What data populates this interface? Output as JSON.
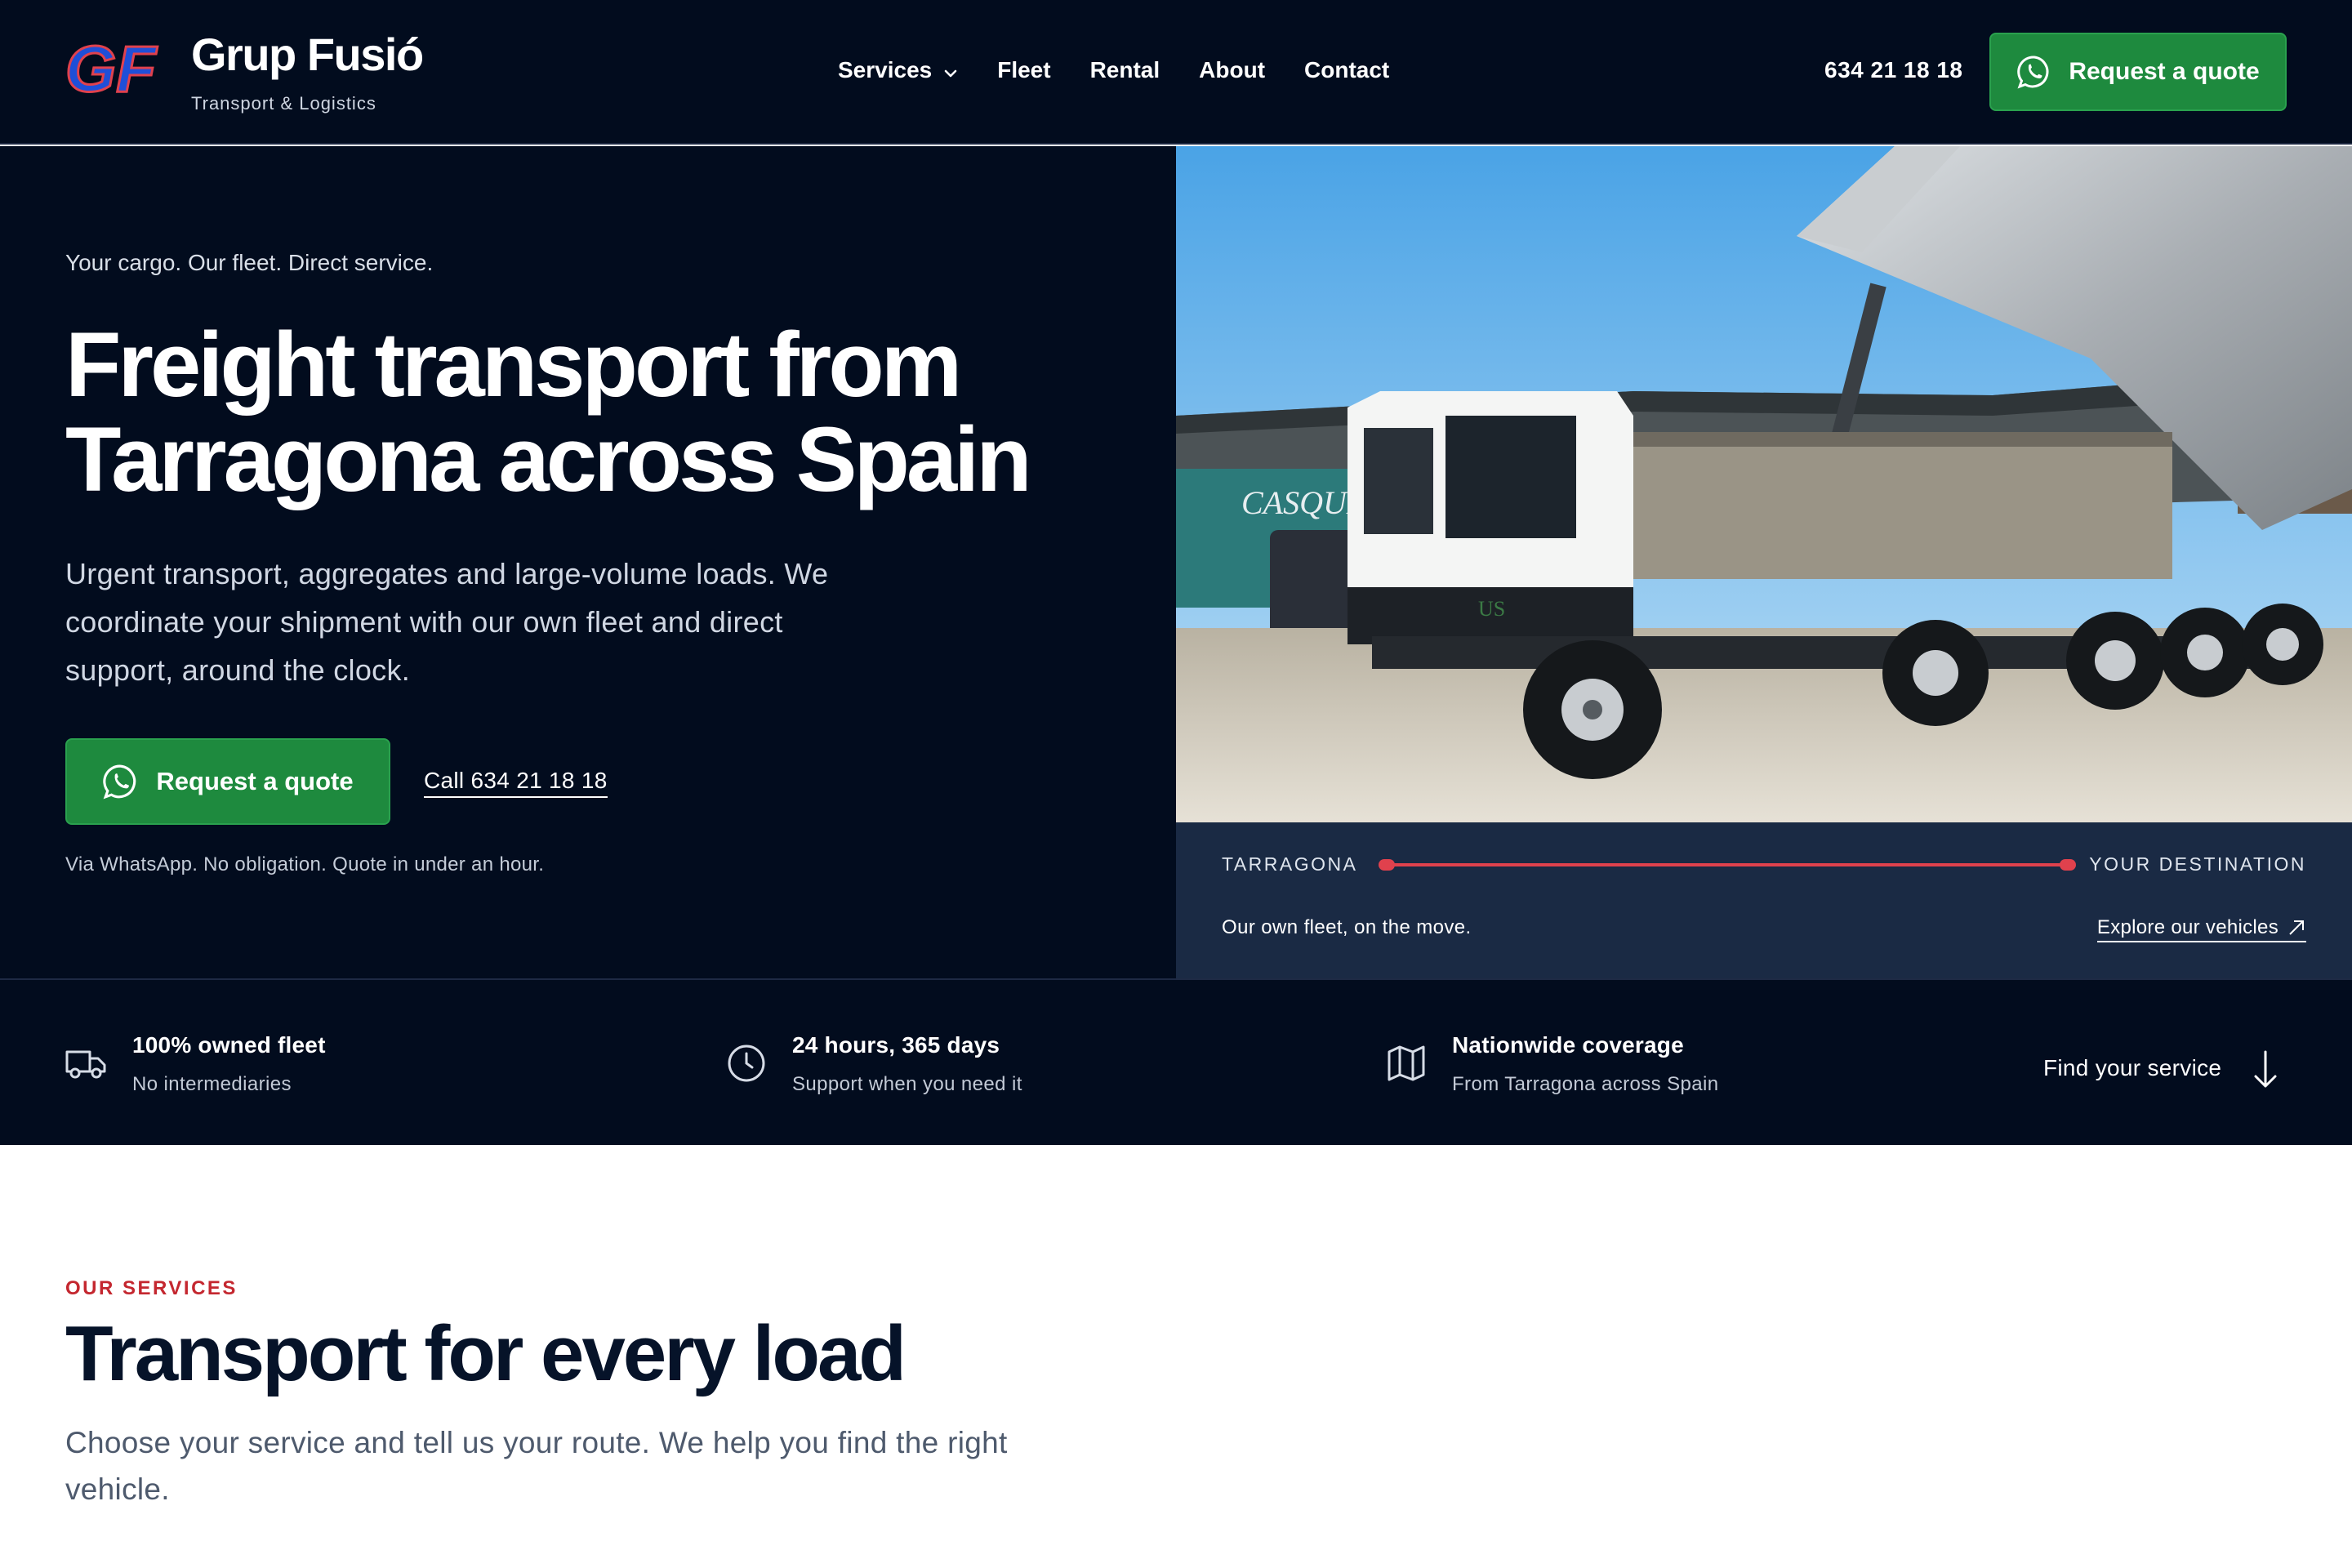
{
  "nav": {
    "brand_name": "Grup Fusió",
    "brand_tagline": "Transport & Logistics",
    "logo_letters": "GF",
    "links": [
      "Services",
      "Fleet",
      "Rental",
      "About",
      "Contact"
    ],
    "phone": "634 21 18 18",
    "cta_label": "Request a quote"
  },
  "hero": {
    "eyebrow": "Your cargo. Our fleet. Direct service.",
    "title": "Freight transport from Tarragona across Spain",
    "subtitle": "Urgent transport, aggregates and large-volume loads. We coordinate your shipment with our own fleet and direct support, around the clock.",
    "cta_label": "Request a quote",
    "call_label": "Call 634 21 18 18",
    "note": "Via WhatsApp. No obligation. Quote in under an hour."
  },
  "route": {
    "origin": "TARRAGONA",
    "destination": "YOUR DESTINATION",
    "caption": "Our own fleet, on the move.",
    "link_label": "Explore our vehicles"
  },
  "photo": {
    "trailer_text": "CASQUE",
    "cab_text": "US"
  },
  "features": [
    {
      "title": "100% owned fleet",
      "subtitle": "No intermediaries",
      "icon": "truck-icon"
    },
    {
      "title": "24 hours, 365 days",
      "subtitle": "Support when you need it",
      "icon": "clock-icon"
    },
    {
      "title": "Nationwide coverage",
      "subtitle": "From Tarragona across Spain",
      "icon": "map-icon"
    }
  ],
  "find_service": "Find your service",
  "services": {
    "kicker": "OUR SERVICES",
    "title": "Transport for every load",
    "subtitle": "Choose your service and tell us your route. We help you find the right vehicle."
  },
  "colors": {
    "navy": "#020c1e",
    "panel": "#1a2a44",
    "green": "#1e8a3e",
    "red_accent": "#e0414d",
    "kicker_red": "#c4272f"
  }
}
